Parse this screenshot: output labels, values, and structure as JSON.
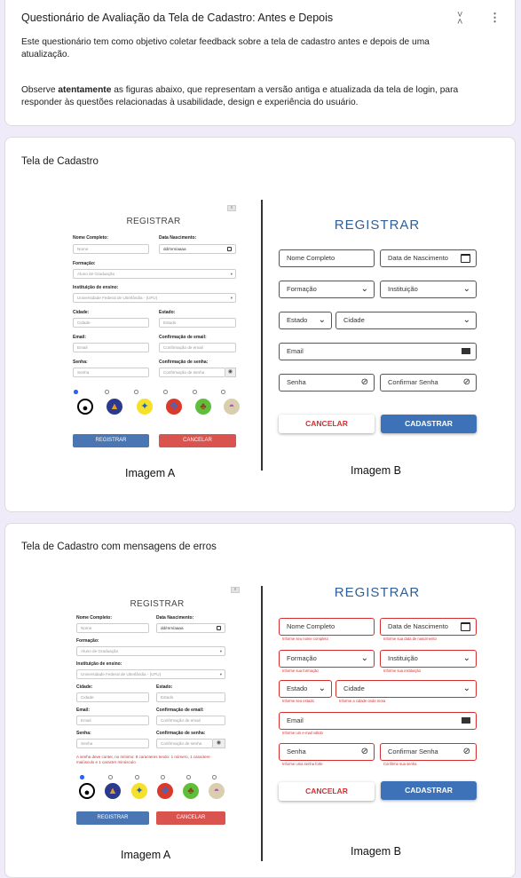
{
  "header": {
    "title": "Questionário de Avaliação da Tela de Cadastro: Antes e Depois",
    "intro": "Este questionário tem como objetivo coletar feedback sobre a tela de cadastro antes e depois de uma atualização.",
    "instr_pre": "Observe ",
    "instr_bold": "atentamente",
    "instr_post": " as figuras abaixo, que representam a versão antiga e atualizada da tela de login, para responder às questões relacionadas à usabilidade, design e experiência do usuário."
  },
  "section1": {
    "title": "Tela de Cadastro",
    "caption_a": "Imagem A",
    "caption_b": "Imagem B"
  },
  "section2": {
    "title": "Tela de Cadastro com mensagens de erros",
    "caption_a": "Imagem A",
    "caption_b": "Imagem B"
  },
  "imgA": {
    "title": "REGISTRAR",
    "close": "x",
    "nome_label": "Nome Completo:",
    "nome_ph": "Nome",
    "nasc_label": "Data Nascimento:",
    "nasc_ph": "dd/mm/aaaa",
    "formacao_label": "Formação:",
    "formacao_val": "Aluno de Graduação",
    "inst_label": "Instituição de ensino:",
    "inst_val": "Universidade Federal de Uberlândia - (UFU)",
    "cidade_label": "Cidade:",
    "cidade_ph": "Cidade",
    "estado_label": "Estado:",
    "estado_ph": "Estado",
    "email_label": "Email:",
    "email_ph": "Email",
    "confemail_label": "Confirmação de email:",
    "confemail_ph": "Confirmação de email",
    "senha_label": "Senha:",
    "senha_ph": "Senha",
    "confsenha_label": "Confirmação de senha:",
    "confsenha_ph": "Confirmação de senha",
    "error": "A senha deve conter, no mínimo: 8 caracteres tendo: 1 número, 1 caractere maiúsculo e 1 caracter minúsculo",
    "btn_registrar": "REGISTRAR",
    "btn_cancelar": "CANCELAR",
    "colors": {
      "primary": "#4a76b3",
      "danger": "#d9534f"
    }
  },
  "imgB": {
    "title": "REGISTRAR",
    "nome": "Nome Completo",
    "nasc": "Data de Nascimento",
    "formacao": "Formação",
    "inst": "Instituição",
    "estado": "Estado",
    "cidade": "Cidade",
    "email": "Email",
    "senha": "Senha",
    "confsenha": "Confirmar Senha",
    "btn_cancelar": "CANCELAR",
    "btn_cadastrar": "CADASTRAR",
    "hints": {
      "nome": "Informe seu nome completo",
      "nasc": "Informe sua data de nascimento",
      "formacao": "Informe sua formação",
      "inst": "Informe sua instituição",
      "estado": "Informe seu estado",
      "cidade": "Informe a cidade onde mora",
      "email": "Informe um e-mail válido",
      "senha": "Informe uma senha forte",
      "confsenha": "Confirme sua senha"
    },
    "colors": {
      "title": "#2f5f96",
      "primary": "#3d72b8",
      "error": "#d32f2f"
    }
  },
  "avatars": [
    "user-icon",
    "globe-icon",
    "bird-icon",
    "butterfly-icon",
    "tree-icon",
    "rainbow-icon"
  ]
}
